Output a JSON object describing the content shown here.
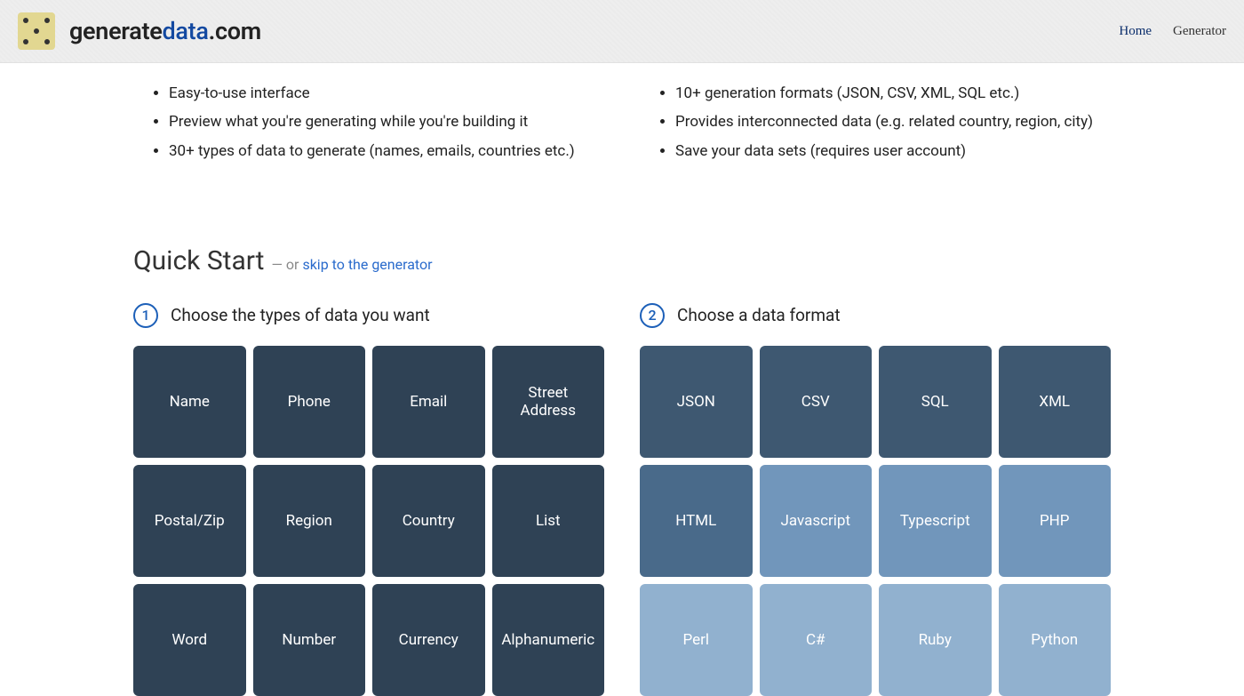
{
  "header": {
    "brand": {
      "part1": "generate",
      "part2": "data",
      "part3": ".com"
    },
    "nav": {
      "home": "Home",
      "generator": "Generator"
    }
  },
  "features": {
    "left": [
      "Easy-to-use interface",
      "Preview what you're generating while you're building it",
      "30+ types of data to generate (names, emails, countries etc.)"
    ],
    "right": [
      "10+ generation formats (JSON, CSV, XML, SQL etc.)",
      "Provides interconnected data (e.g. related country, region, city)",
      "Save your data sets (requires user account)"
    ]
  },
  "quickstart": {
    "title": "Quick Start",
    "sub_prefix": " — or ",
    "sub_link": "skip to the generator"
  },
  "steps": {
    "s1": {
      "num": "1",
      "label": "Choose the types of data you want"
    },
    "s2": {
      "num": "2",
      "label": "Choose a data format"
    }
  },
  "data_types": [
    {
      "label": "Name",
      "shade": "shade1"
    },
    {
      "label": "Phone",
      "shade": "shade1"
    },
    {
      "label": "Email",
      "shade": "shade1"
    },
    {
      "label": "Street Address",
      "shade": "shade1"
    },
    {
      "label": "Postal/Zip",
      "shade": "shade1"
    },
    {
      "label": "Region",
      "shade": "shade1"
    },
    {
      "label": "Country",
      "shade": "shade1"
    },
    {
      "label": "List",
      "shade": "shade1"
    },
    {
      "label": "Word",
      "shade": "shade1"
    },
    {
      "label": "Number",
      "shade": "shade1"
    },
    {
      "label": "Currency",
      "shade": "shade1"
    },
    {
      "label": "Alphanumeric",
      "shade": "shade1"
    }
  ],
  "formats": [
    {
      "label": "JSON",
      "shade": "shade2"
    },
    {
      "label": "CSV",
      "shade": "shade2"
    },
    {
      "label": "SQL",
      "shade": "shade2"
    },
    {
      "label": "XML",
      "shade": "shade2"
    },
    {
      "label": "HTML",
      "shade": "shade3"
    },
    {
      "label": "Javascript",
      "shade": "shade4"
    },
    {
      "label": "Typescript",
      "shade": "shade4"
    },
    {
      "label": "PHP",
      "shade": "shade4"
    },
    {
      "label": "Perl",
      "shade": "shade5"
    },
    {
      "label": "C#",
      "shade": "shade5"
    },
    {
      "label": "Ruby",
      "shade": "shade5"
    },
    {
      "label": "Python",
      "shade": "shade5"
    }
  ]
}
